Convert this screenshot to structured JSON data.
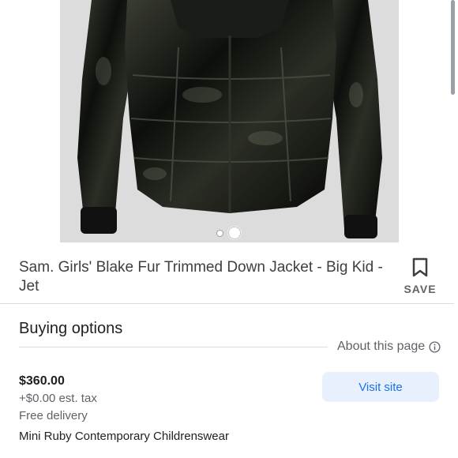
{
  "product": {
    "title": "Sam. Girls' Blake Fur Trimmed Down Jacket - Big Kid - Jet",
    "image_subject": "black puffer down jacket",
    "carousel_active_index": 1,
    "carousel_count": 2
  },
  "save": {
    "label": "SAVE",
    "icon": "bookmark-icon"
  },
  "buying": {
    "heading": "Buying options",
    "about_label": "About this page",
    "about_icon": "info-icon"
  },
  "offer": {
    "price": "$360.00",
    "tax": "+$0.00 est. tax",
    "delivery": "Free delivery",
    "seller": "Mini Ruby Contemporary Childrenswear",
    "visit_label": "Visit site"
  },
  "colors": {
    "accent_blue": "#1a73e8",
    "button_bg": "#e8f0fe",
    "text_primary": "#202124",
    "text_secondary": "#5f6368"
  }
}
